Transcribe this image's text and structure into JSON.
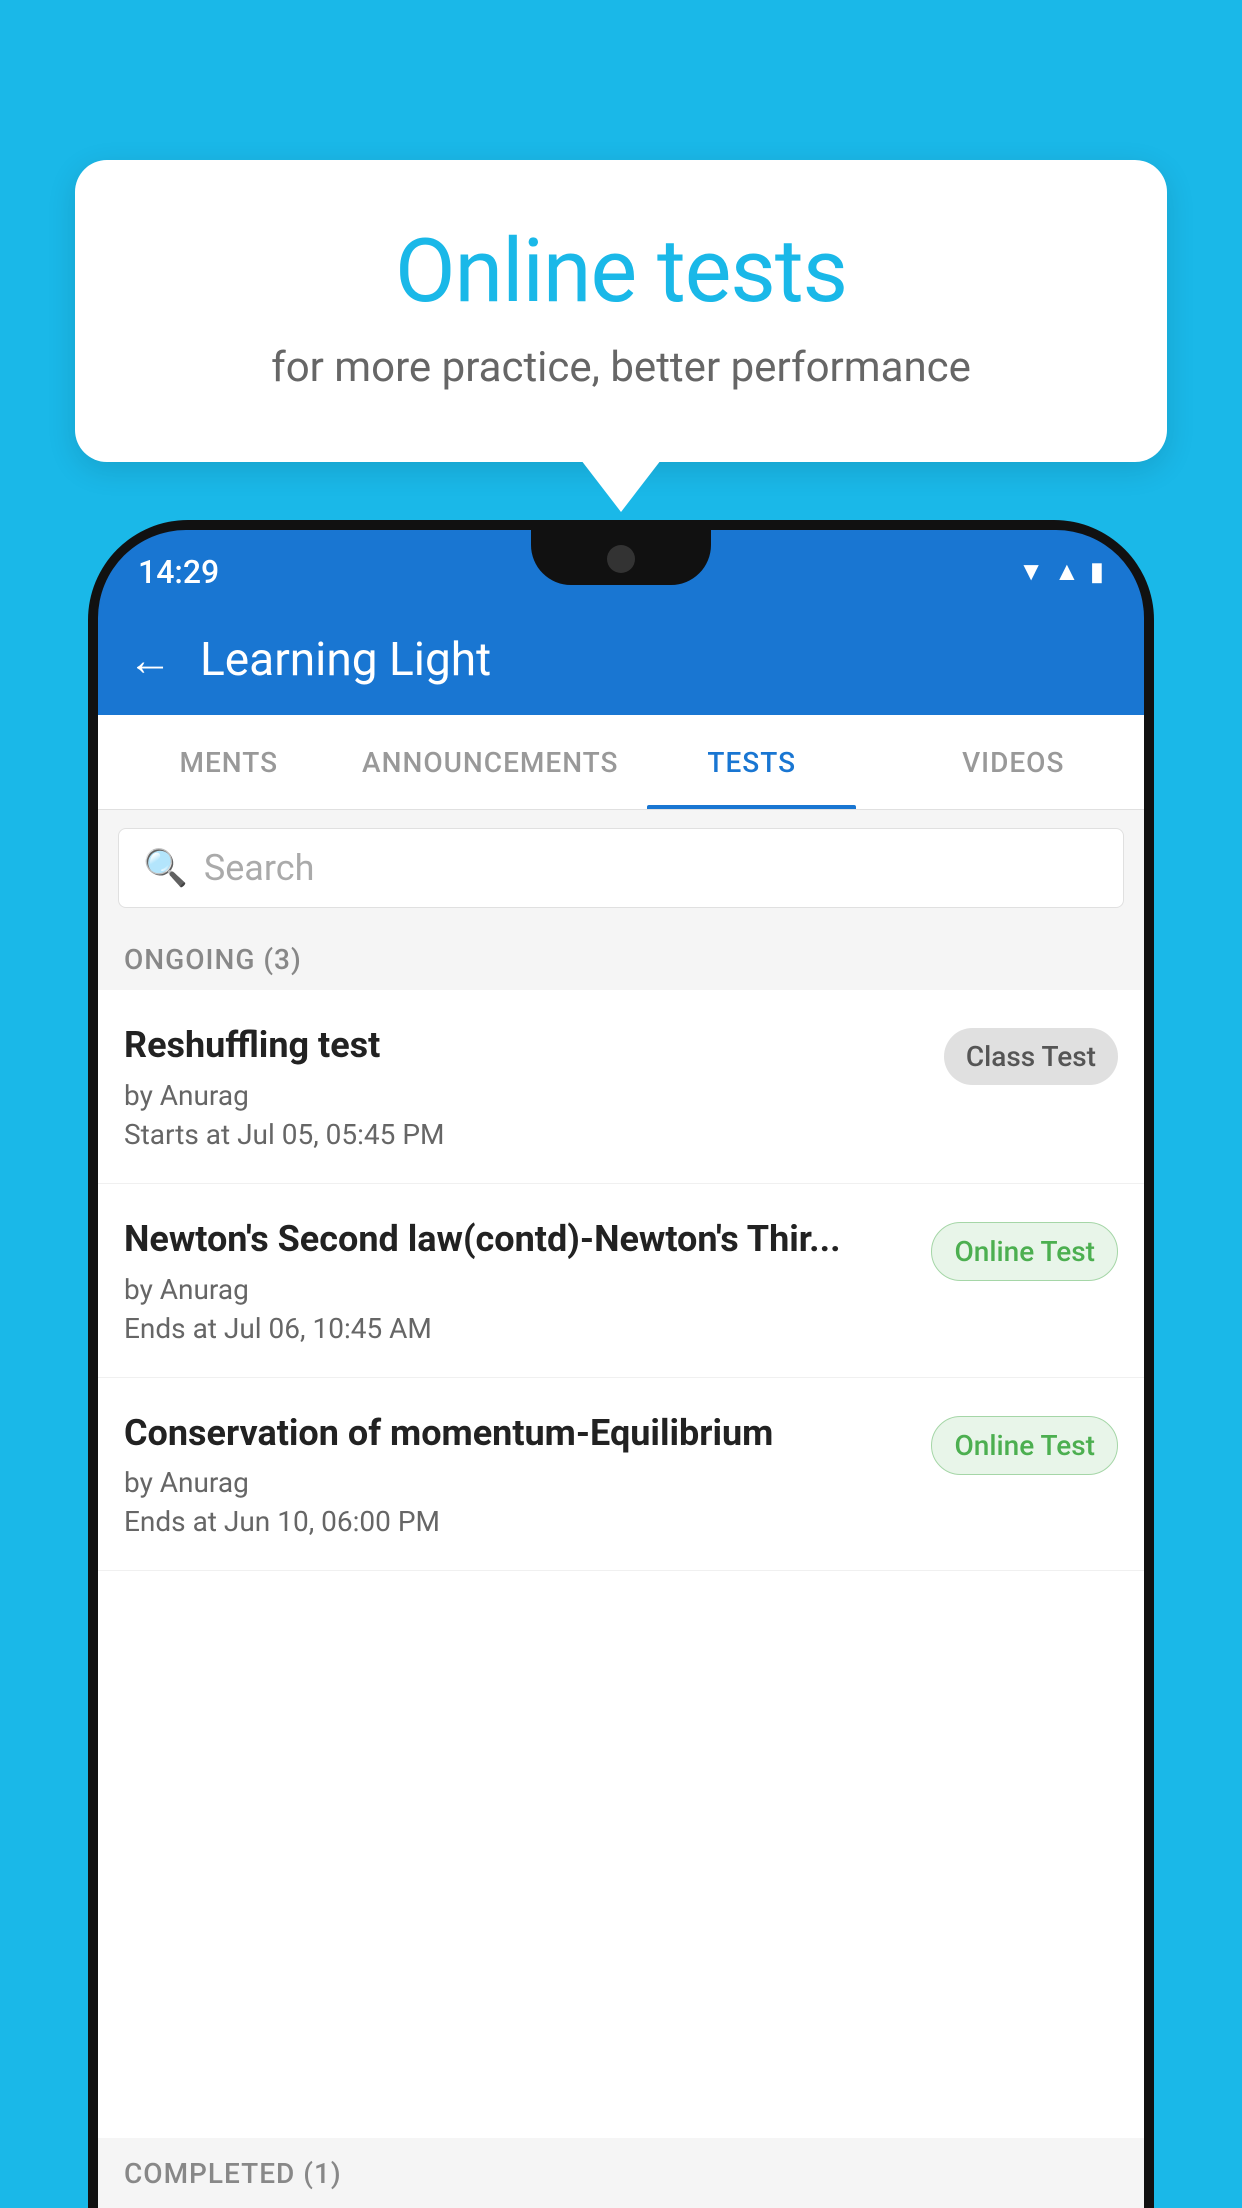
{
  "background_color": "#1ab8e8",
  "bubble": {
    "title": "Online tests",
    "subtitle": "for more practice, better performance"
  },
  "phone": {
    "status_bar": {
      "time": "14:29",
      "icons": [
        "wifi",
        "signal",
        "battery"
      ]
    },
    "app_bar": {
      "back_label": "←",
      "title": "Learning Light"
    },
    "tabs": [
      {
        "label": "MENTS",
        "active": false
      },
      {
        "label": "ANNOUNCEMENTS",
        "active": false
      },
      {
        "label": "TESTS",
        "active": true
      },
      {
        "label": "VIDEOS",
        "active": false
      }
    ],
    "search": {
      "placeholder": "Search"
    },
    "ongoing_section": {
      "label": "ONGOING (3)"
    },
    "tests": [
      {
        "name": "Reshuffling test",
        "by": "by Anurag",
        "date_label": "Starts at",
        "date": "Jul 05, 05:45 PM",
        "badge": "Class Test",
        "badge_type": "class"
      },
      {
        "name": "Newton's Second law(contd)-Newton's Thir...",
        "by": "by Anurag",
        "date_label": "Ends at",
        "date": "Jul 06, 10:45 AM",
        "badge": "Online Test",
        "badge_type": "online"
      },
      {
        "name": "Conservation of momentum-Equilibrium",
        "by": "by Anurag",
        "date_label": "Ends at",
        "date": "Jun 10, 06:00 PM",
        "badge": "Online Test",
        "badge_type": "online"
      }
    ],
    "completed_section": {
      "label": "COMPLETED (1)"
    }
  }
}
